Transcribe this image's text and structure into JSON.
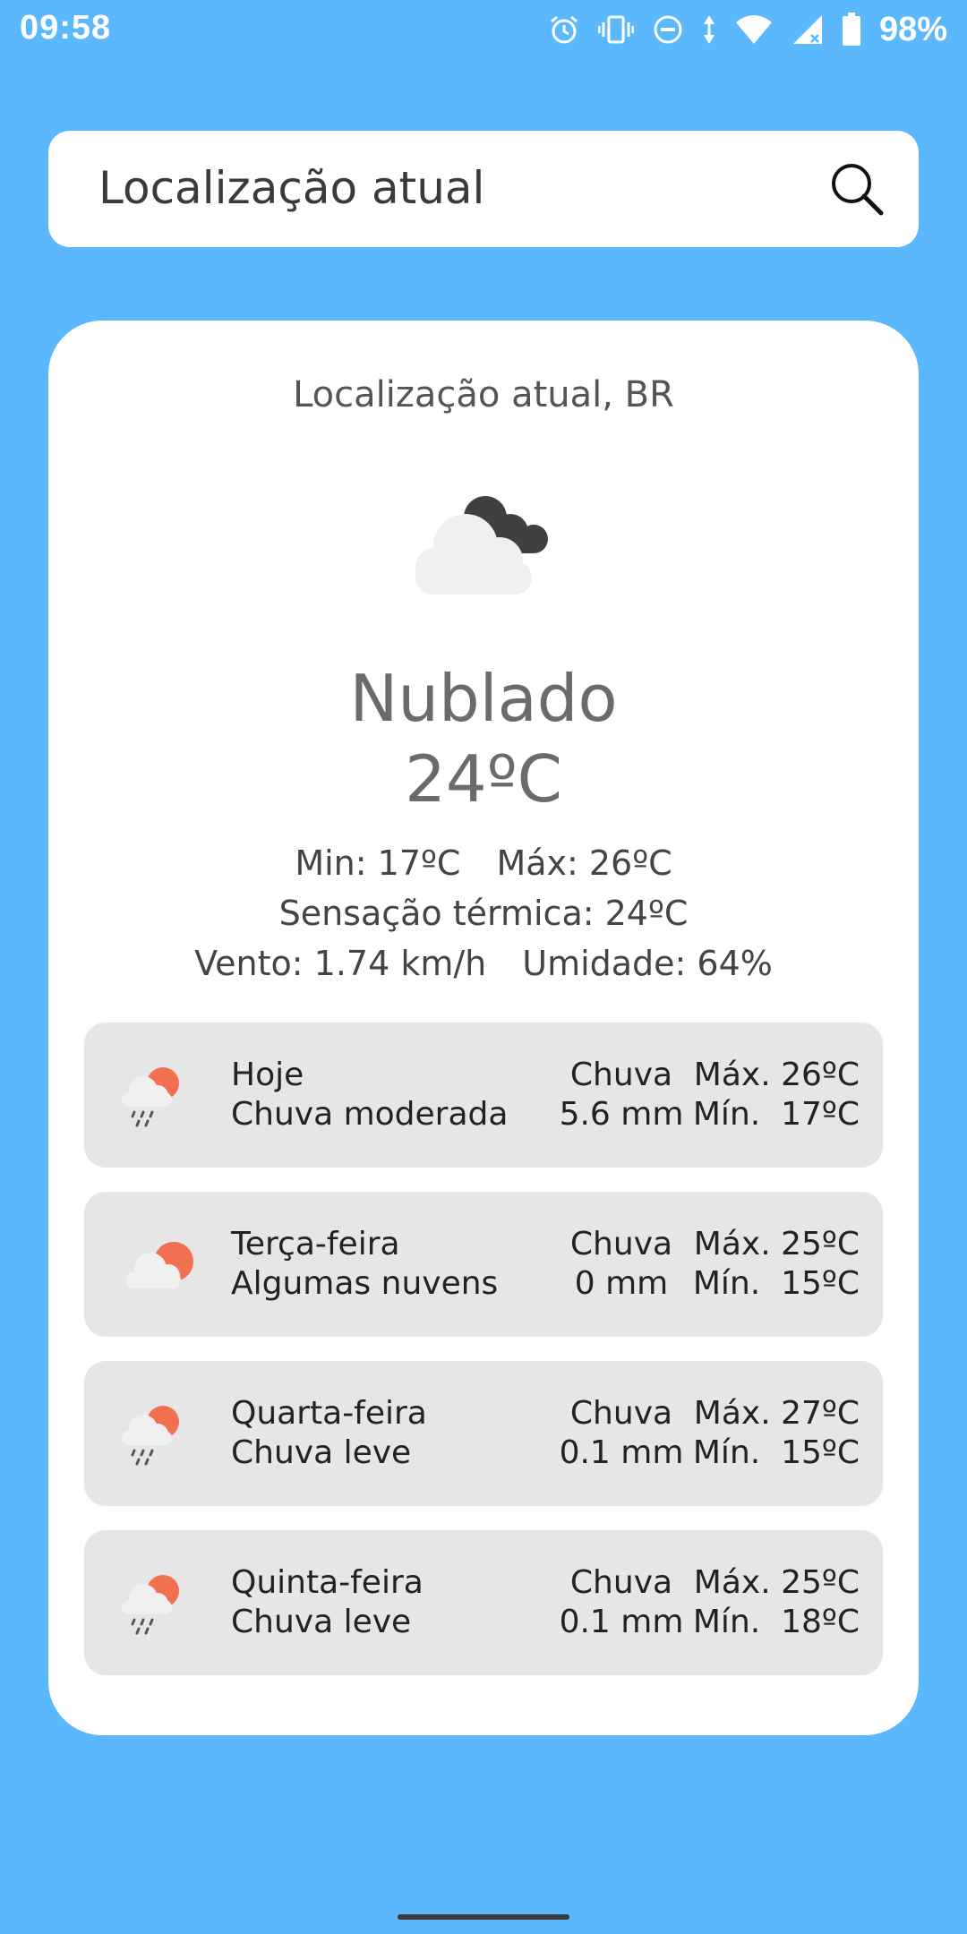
{
  "status_bar": {
    "time": "09:58",
    "battery": "98%",
    "icons": [
      "alarm-icon",
      "vibrate-icon",
      "dnd-icon",
      "data-arrows-icon",
      "wifi-icon",
      "signal-icon",
      "battery-icon"
    ]
  },
  "search": {
    "text": "Localização atual",
    "icon": "search-icon"
  },
  "current": {
    "location": "Localização atual, BR",
    "icon": "cloudy-icon",
    "condition": "Nublado",
    "temperature": "24ºC",
    "min": "Min: 17ºC",
    "max": "Máx: 26ºC",
    "feels_like": "Sensação térmica: 24ºC",
    "wind": "Vento: 1.74 km/h",
    "humidity": "Umidade: 64%"
  },
  "forecast": [
    {
      "day": "Hoje",
      "description": "Chuva moderada",
      "icon": "rain-sun-icon",
      "rain_label": "Chuva",
      "rain_value": "5.6 mm",
      "max": "Máx. 26ºC",
      "min": "Mín.  17ºC"
    },
    {
      "day": "Terça-feira",
      "description": "Algumas nuvens",
      "icon": "partly-cloudy-icon",
      "rain_label": "Chuva",
      "rain_value": "0 mm",
      "max": "Máx. 25ºC",
      "min": "Mín.  15ºC"
    },
    {
      "day": "Quarta-feira",
      "description": "Chuva leve",
      "icon": "rain-sun-icon",
      "rain_label": "Chuva",
      "rain_value": "0.1 mm",
      "max": "Máx. 27ºC",
      "min": "Mín.  15ºC"
    },
    {
      "day": "Quinta-feira",
      "description": "Chuva leve",
      "icon": "rain-sun-icon",
      "rain_label": "Chuva",
      "rain_value": "0.1 mm",
      "max": "Máx. 25ºC",
      "min": "Mín.  18ºC"
    }
  ],
  "colors": {
    "background": "#5cb8fd",
    "card": "#ffffff",
    "forecast_row": "#e6e6e6",
    "sun": "#f07050",
    "cloud_light": "#f0f0f0",
    "cloud_dark": "#404040"
  }
}
